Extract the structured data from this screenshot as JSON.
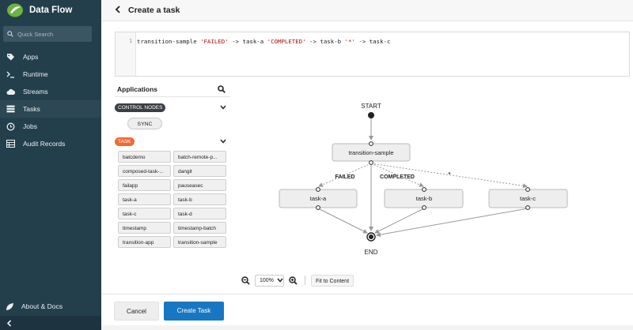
{
  "app": {
    "name": "Data Flow"
  },
  "sidebar": {
    "search_placeholder": "Quick Search",
    "items": [
      {
        "label": "Apps",
        "icon": "tag-icon"
      },
      {
        "label": "Runtime",
        "icon": "terminal-icon"
      },
      {
        "label": "Streams",
        "icon": "cloud-icon"
      },
      {
        "label": "Tasks",
        "icon": "list-icon"
      },
      {
        "label": "Jobs",
        "icon": "clock-icon"
      },
      {
        "label": "Audit Records",
        "icon": "table-icon"
      }
    ],
    "about_label": "About & Docs",
    "collapse_icon": "chevron-left-icon"
  },
  "header": {
    "title": "Create a task",
    "back_icon": "chevron-left-icon"
  },
  "editor": {
    "line_number": "1",
    "parts": [
      {
        "t": "transition-sample ",
        "c": "plain"
      },
      {
        "t": "'FAILED'",
        "c": "str"
      },
      {
        "t": " -> task-a ",
        "c": "plain"
      },
      {
        "t": "'COMPLETED'",
        "c": "str"
      },
      {
        "t": " -> task-b ",
        "c": "plain"
      },
      {
        "t": "'*'",
        "c": "str"
      },
      {
        "t": " -> task-c",
        "c": "plain"
      }
    ]
  },
  "applications": {
    "title": "Applications",
    "control_nodes_label": "CONTROL NODES",
    "control_nodes": [
      "SYNC"
    ],
    "task_group_label": "TASK",
    "tasks": [
      "batcdemo",
      "batch-remote-p...",
      "composed-task-...",
      "dangit",
      "failapp",
      "pauseasec",
      "task-a",
      "task-b",
      "task-c",
      "task-d",
      "timestamp",
      "timestamp-batch",
      "transition-app",
      "transition-sample"
    ]
  },
  "graph": {
    "start_label": "START",
    "end_label": "END",
    "root_node": "transition-sample",
    "nodes": [
      "task-a",
      "task-b",
      "task-c"
    ],
    "edge_labels": [
      "FAILED",
      "COMPLETED",
      "*"
    ]
  },
  "zoom": {
    "level": "100%",
    "fit_label": "Fit to Content"
  },
  "footer": {
    "cancel_label": "Cancel",
    "create_label": "Create Task"
  },
  "colors": {
    "sidebar": "#243f4c",
    "primary": "#1877c2",
    "task_pill": "#f06a35",
    "control_pill": "#3a3f44"
  }
}
